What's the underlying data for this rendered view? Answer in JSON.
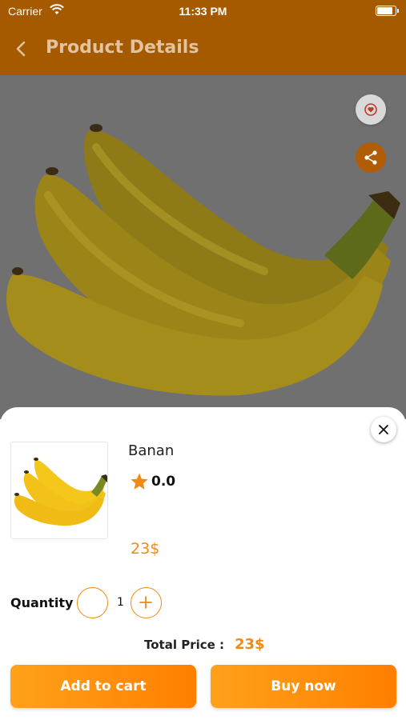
{
  "status_bar": {
    "carrier": "Carrier",
    "time": "11:33 PM"
  },
  "header": {
    "title": "Product Details",
    "back_icon": "chevron-left-icon"
  },
  "hero": {
    "favorite_icon": "heart-badge-icon",
    "share_icon": "share-icon"
  },
  "product": {
    "name": "Banan",
    "rating": "0.0",
    "price": "23$"
  },
  "quantity": {
    "label": "Quantity",
    "value": "1"
  },
  "total": {
    "label": "Total Price :",
    "value": "23$"
  },
  "actions": {
    "add_to_cart": "Add to cart",
    "buy_now": "Buy now"
  },
  "colors": {
    "header": "#a55a00",
    "accent": "#ef8a12",
    "button_gradient_start": "#ffa11a",
    "button_gradient_end": "#ff7f00"
  }
}
